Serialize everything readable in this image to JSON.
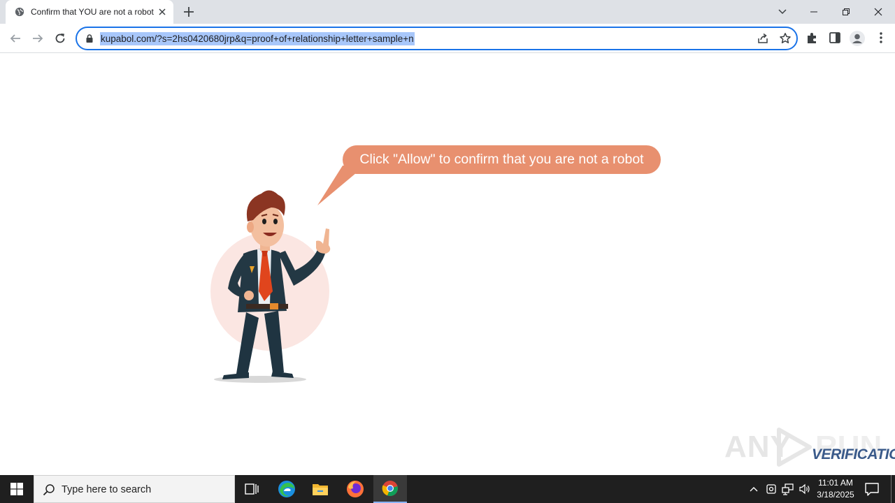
{
  "browser": {
    "tab": {
      "title": "Confirm that YOU are not a robot"
    },
    "omnibox": {
      "url": "kupabol.com/?s=2hs0420680jrp&q=proof+of+relationship+letter+sample+n"
    },
    "accent_color": "#1a73e8"
  },
  "page": {
    "bubble_text": "Click \"Allow\" to confirm that you are not a robot",
    "bubble_color": "#e8906f",
    "watermark": {
      "left": "ANY",
      "right": "RUN",
      "sub": "VERIFICATION"
    }
  },
  "taskbar": {
    "search_placeholder": "Type here to search",
    "clock_time": "11:01 AM",
    "clock_date": "3/18/2025",
    "apps": [
      "task-view",
      "edge",
      "file-explorer",
      "firefox",
      "chrome"
    ]
  }
}
